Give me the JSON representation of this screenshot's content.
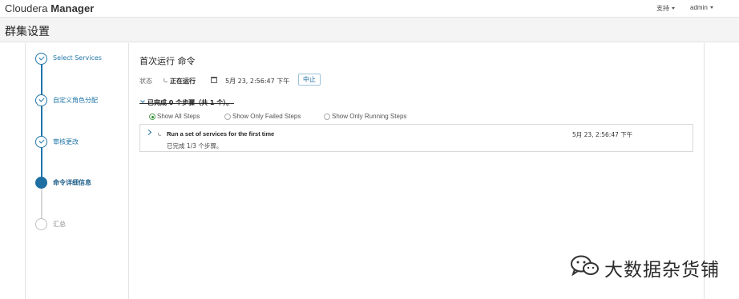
{
  "app": {
    "brand_light": "Cloudera",
    "brand_bold": "Manager"
  },
  "topnav": {
    "support": "支持",
    "user": "admin"
  },
  "page": {
    "title": "群集设置"
  },
  "steps": [
    {
      "label": "Select Services",
      "state": "done"
    },
    {
      "label": "自定义角色分配",
      "state": "done"
    },
    {
      "label": "审核更改",
      "state": "done"
    },
    {
      "label": "命令详细信息",
      "state": "active"
    },
    {
      "label": "汇总",
      "state": "pending"
    }
  ],
  "command": {
    "title": "首次运行 命令",
    "status_label": "状态",
    "status_value": "正在运行",
    "start_time": "5月 23, 2:56:47 下午",
    "abort_label": "中止",
    "summary": "已完成 0 个步骤（共 1 个）。"
  },
  "filters": [
    {
      "label": "Show All Steps",
      "selected": true
    },
    {
      "label": "Show Only Failed Steps",
      "selected": false
    },
    {
      "label": "Show Only Running Steps",
      "selected": false
    }
  ],
  "steps_table": [
    {
      "title": "Run a set of services for the first time",
      "progress": "已完成  1/3  个步骤。",
      "time": "5月 23, 2:56:47 下午"
    }
  ],
  "watermark": {
    "text": "大数据杂货铺"
  },
  "colors": {
    "accent": "#1f75a8",
    "success": "#2a8a2a"
  }
}
